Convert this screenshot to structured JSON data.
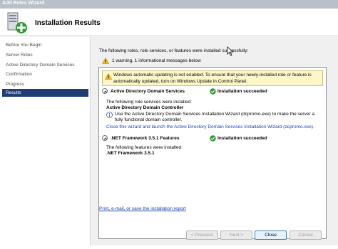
{
  "window": {
    "title": "Add Roles Wizard"
  },
  "header": {
    "title": "Installation Results",
    "icon": "server-roles-add-icon"
  },
  "sidebar": {
    "items": [
      {
        "label": "Before You Begin",
        "active": false
      },
      {
        "label": "Server Roles",
        "active": false
      },
      {
        "label": "Active Directory Domain Services",
        "active": false
      },
      {
        "label": "Confirmation",
        "active": false
      },
      {
        "label": "Progress",
        "active": false
      },
      {
        "label": "Results",
        "active": true
      }
    ]
  },
  "main": {
    "intro": "The following roles, role services, or features were installed successfully:",
    "summary": "1 warning, 1 informational messages below",
    "warning": "Windows automatic updating is not enabled. To ensure that your newly-installed role or feature is automatically updated, turn on Windows Update in Control Panel.",
    "sections": [
      {
        "name": "Active Directory Domain Services",
        "status": "Installation succeeded",
        "installed_label": "The following role services were installed:",
        "installed_item": "Active Directory Domain Controller",
        "info": "Use the Active Directory Domain Services Installation Wizard (dcpromo.exe) to make the server a fully functional domain controller.",
        "link": "Close this wizard and launch the Active Directory Domain Services Installation Wizard (dcpromo.exe)."
      },
      {
        "name": ".NET Framework 3.5.1 Features",
        "status": "Installation succeeded",
        "installed_label": "The following features were installed:",
        "installed_item": ".NET Framework 3.5.1"
      }
    ],
    "report_link": "Print, e-mail, or save the installation report"
  },
  "buttons": {
    "previous": "< Previous",
    "next": "Next >",
    "close": "Close",
    "cancel": "Cancel"
  },
  "colors": {
    "selected_nav": "#1f3c75",
    "link": "#1a44b4",
    "warning_banner": "#fdf6c8",
    "success": "#2e9a2e"
  }
}
